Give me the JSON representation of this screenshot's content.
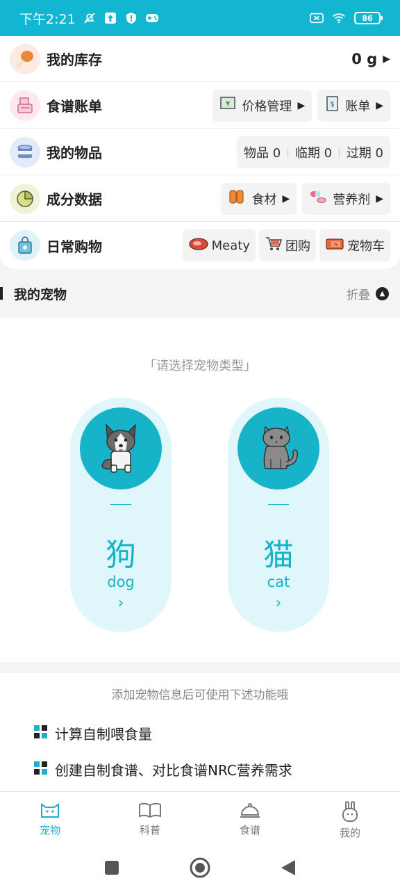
{
  "status_bar": {
    "time": "下午2:21",
    "battery": "86"
  },
  "menu": {
    "stock": {
      "title": "我的库存",
      "value": "0 g"
    },
    "recipe_bill": {
      "title": "食谱账单",
      "price_btn": "价格管理",
      "bill_btn": "账单"
    },
    "items": {
      "title": "我的物品",
      "stats": [
        "物品 0",
        "临期 0",
        "过期 0"
      ]
    },
    "nutrition": {
      "title": "成分数据",
      "food_btn": "食材",
      "supplement_btn": "营养剂"
    },
    "shopping": {
      "title": "日常购物",
      "meaty_btn": "Meaty",
      "group_btn": "团购",
      "cart_btn": "宠物车"
    }
  },
  "pets_section": {
    "title": "我的宠物",
    "fold_label": "折叠"
  },
  "pet_select": {
    "prompt": "「请选择宠物类型」",
    "dog": {
      "cn": "狗",
      "en": "dog"
    },
    "cat": {
      "cn": "猫",
      "en": "cat"
    }
  },
  "info": {
    "note": "添加宠物信息后可使用下述功能哦",
    "features": [
      "计算自制喂食量",
      "创建自制食谱、对比食谱NRC营养需求"
    ]
  },
  "tabs": [
    "宠物",
    "科普",
    "食谱",
    "我的"
  ],
  "colors": {
    "accent": "#16b3c9",
    "status_bar": "#12b6d0"
  }
}
